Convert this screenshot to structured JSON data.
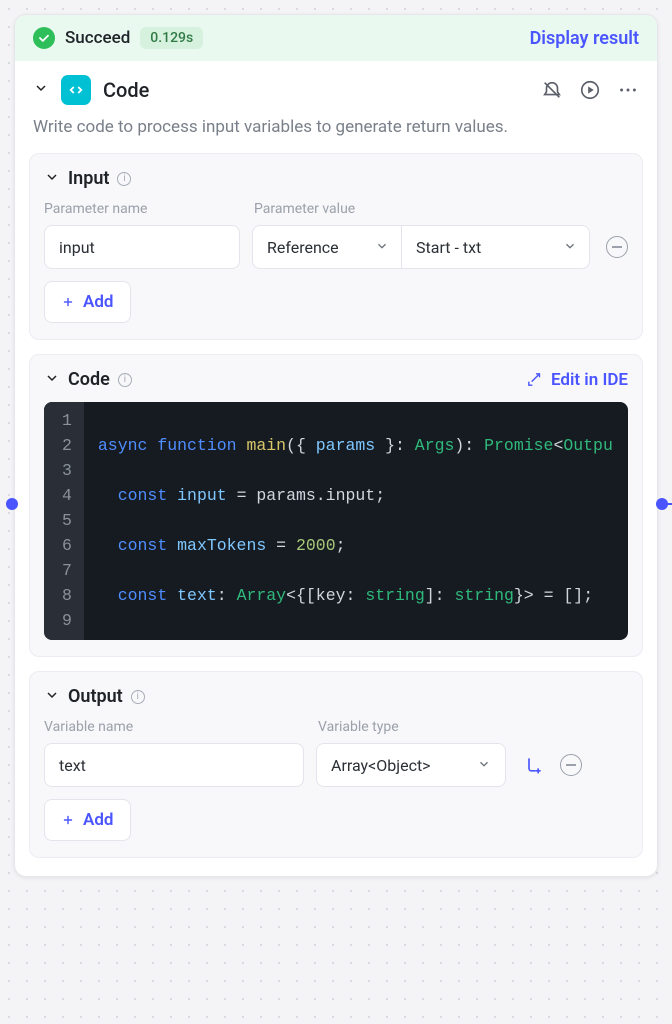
{
  "status": {
    "label": "Succeed",
    "time": "0.129s",
    "display_result": "Display result"
  },
  "header": {
    "title": "Code"
  },
  "description": "Write code to process input variables to generate return values.",
  "input": {
    "section_title": "Input",
    "param_name_label": "Parameter name",
    "param_value_label": "Parameter value",
    "rows": [
      {
        "name": "input",
        "mode": "Reference",
        "ref": "Start - txt"
      }
    ],
    "add_label": "Add"
  },
  "code": {
    "section_title": "Code",
    "edit_label": "Edit in IDE",
    "lines": [
      "1",
      "2",
      "3",
      "4",
      "5",
      "6",
      "7",
      "8",
      "9"
    ]
  },
  "output": {
    "section_title": "Output",
    "var_name_label": "Variable name",
    "var_type_label": "Variable type",
    "rows": [
      {
        "name": "text",
        "type": "Array<Object>"
      }
    ],
    "add_label": "Add"
  }
}
